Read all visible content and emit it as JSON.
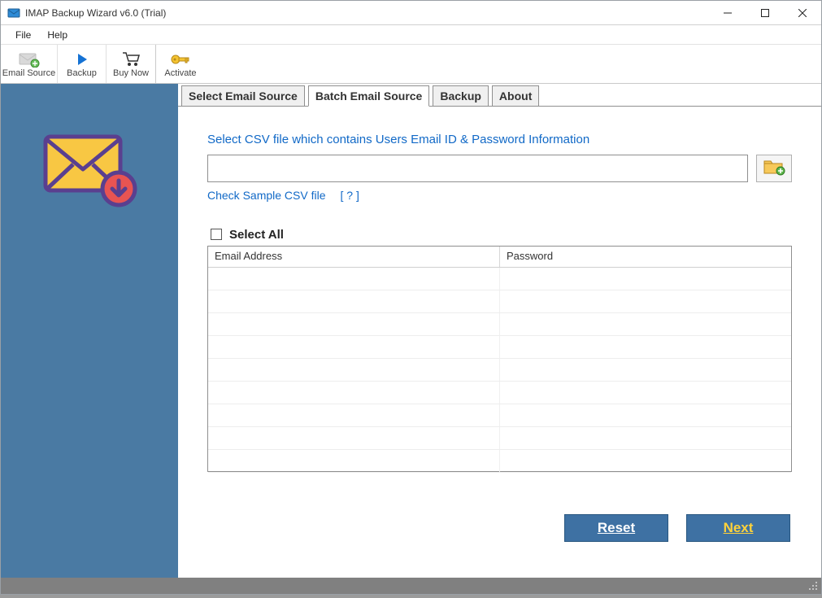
{
  "titlebar": {
    "title": "IMAP Backup Wizard v6.0 (Trial)"
  },
  "menu": {
    "file": "File",
    "help": "Help"
  },
  "toolbar": {
    "email_source": "Email Source",
    "backup": "Backup",
    "buy_now": "Buy Now",
    "activate": "Activate"
  },
  "tabs": {
    "select_email_source": "Select Email Source",
    "batch_email_source": "Batch Email Source",
    "backup": "Backup",
    "about": "About"
  },
  "panel": {
    "instruction": "Select CSV file which contains Users Email ID & Password Information",
    "csv_path_value": "",
    "check_sample": "Check Sample CSV file",
    "help_mark": "[ ? ]",
    "select_all": "Select All",
    "columns": {
      "email": "Email Address",
      "password": "Password"
    },
    "rows": [
      "",
      "",
      "",
      "",
      "",
      "",
      "",
      "",
      ""
    ]
  },
  "buttons": {
    "reset": "Reset",
    "next": "Next"
  }
}
